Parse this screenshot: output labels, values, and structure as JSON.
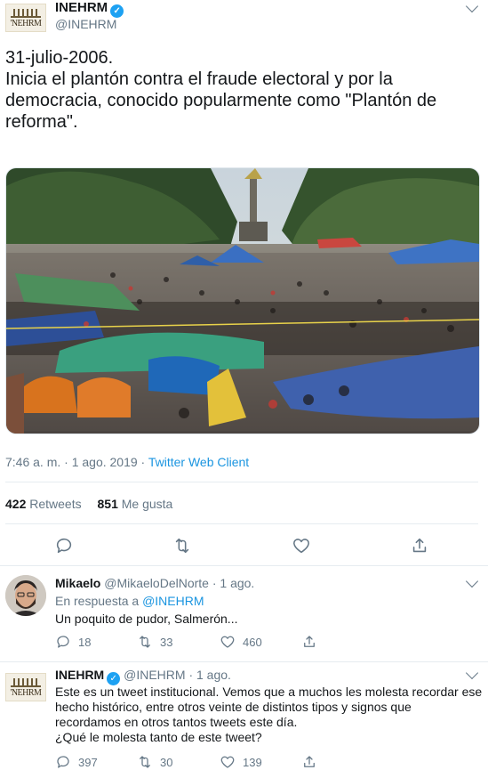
{
  "main_tweet": {
    "author_name": "INEHRM",
    "handle": "@INEHRM",
    "avatar_text": "'NEHRM",
    "text_lines": [
      "31-julio-2006.",
      "Inicia el plantón contra el fraude electoral y por la",
      "democracia, conocido popularmente como \"Plantón de",
      "reforma\"."
    ],
    "time": "7:46 a. m. · 1 ago. 2019 · ",
    "client": "Twitter Web Client",
    "retweets_count": "422",
    "retweets_label": "Retweets",
    "likes_count": "851",
    "likes_label": "Me gusta",
    "actions": [
      "reply-icon",
      "retweet-icon",
      "heart-icon",
      "share-icon"
    ]
  },
  "replies": [
    {
      "author_name": "Mikaelo",
      "handle": "@MikaeloDelNorte",
      "date": "· 1 ago.",
      "reply_to_prefix": "En respuesta a ",
      "reply_to_handle": "@INEHRM",
      "text_lines": [
        "Un poquito de pudor, Salmerón..."
      ],
      "reply_count": "18",
      "retweet_count": "33",
      "like_count": "460"
    },
    {
      "author_name": "INEHRM",
      "handle": "@INEHRM",
      "date": "· 1 ago.",
      "avatar_text": "'NEHRM",
      "text_lines": [
        "Este es un tweet institucional. Vemos que a muchos les molesta recordar ese",
        "hecho histórico, entre otros veinte de distintos tipos y signos que",
        "recordamos en otros tantos tweets este día.",
        "¿Qué le molesta tanto de este tweet?"
      ],
      "reply_count": "397",
      "retweet_count": "30",
      "like_count": "139"
    }
  ],
  "colors": {
    "link": "#1b95e0",
    "muted": "#657786",
    "verified": "#1da1f2",
    "separator": "#e6ecf0"
  }
}
